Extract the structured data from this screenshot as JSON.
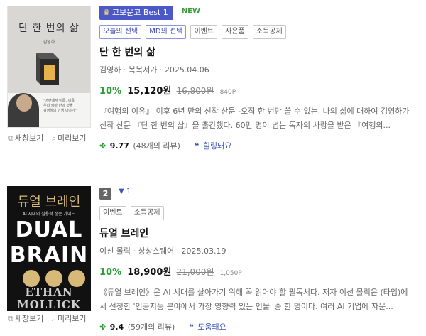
{
  "items": [
    {
      "best_badge": "교보문고 Best 1",
      "new_label": "NEW",
      "tags": [
        "오늘의 선택",
        "MD의 선택",
        "이벤트",
        "사은품",
        "소득공제"
      ],
      "title": "단 한 번의 삶",
      "meta": "김영하 · 복복서가 · 2025.04.06",
      "discount": "10%",
      "price": "15,120원",
      "original_price": "16,800원",
      "points": "840P",
      "description": "『여행의 이유』 이후 6년 만의 신작 산문 -오직 한 번만 쓸 수 있는, 나의 삶에 대하여 김영하가 신작 산문 『단 한 번의 삶』을 출간했다. 60만 명이 넘는 독자의 사랑을 받은 『여행의...",
      "rating": "9.77",
      "reviews": "(48개의 리뷰)",
      "helpful_label": "힐링돼요",
      "cover": {
        "title": "단 한 번의 삶",
        "author": "김영하",
        "blurb": [
          "\"어떤에서 이름, 이름",
          "우리 엄마 만의 것을",
          "김영하의 인생 이야기\""
        ]
      },
      "tools": {
        "new_window": "새창보기",
        "preview": "미리보기"
      }
    },
    {
      "rank": "2",
      "trend": "▼ 1",
      "tags": [
        "이벤트",
        "소득공제"
      ],
      "title": "듀얼 브레인",
      "meta": "이선 몰릭 · 상상스퀘어 · 2025.03.19",
      "discount": "10%",
      "price": "18,900원",
      "original_price": "21,000원",
      "points": "1,050P",
      "description": "《듀얼 브레인》은 AI 시대를 살아가기 위해 꼭 읽어야 할 필독서다. 저자 이선 몰릭은 (타임)에서 선정한 '인공지능 분야에서 가장 영향력 있는 인물' 중 한 명이다. 여러 AI 기업에 자문...",
      "rating": "9.4",
      "reviews": "(59개의 리뷰)",
      "helpful_label": "도움돼요",
      "cover": {
        "top": "듀얼 브레인",
        "subtitle": "AI 시대의 실용적 생존 가이드",
        "line1": "DUAL",
        "line2": "BRAIN",
        "bottom": "ETHAN MOLLICK"
      },
      "tools": {
        "new_window": "새창보기",
        "preview": "미리보기"
      }
    }
  ],
  "colors": {
    "accent_blue": "#4a58c8",
    "discount_green": "#2fa039",
    "link_blue": "#3b56b7"
  }
}
